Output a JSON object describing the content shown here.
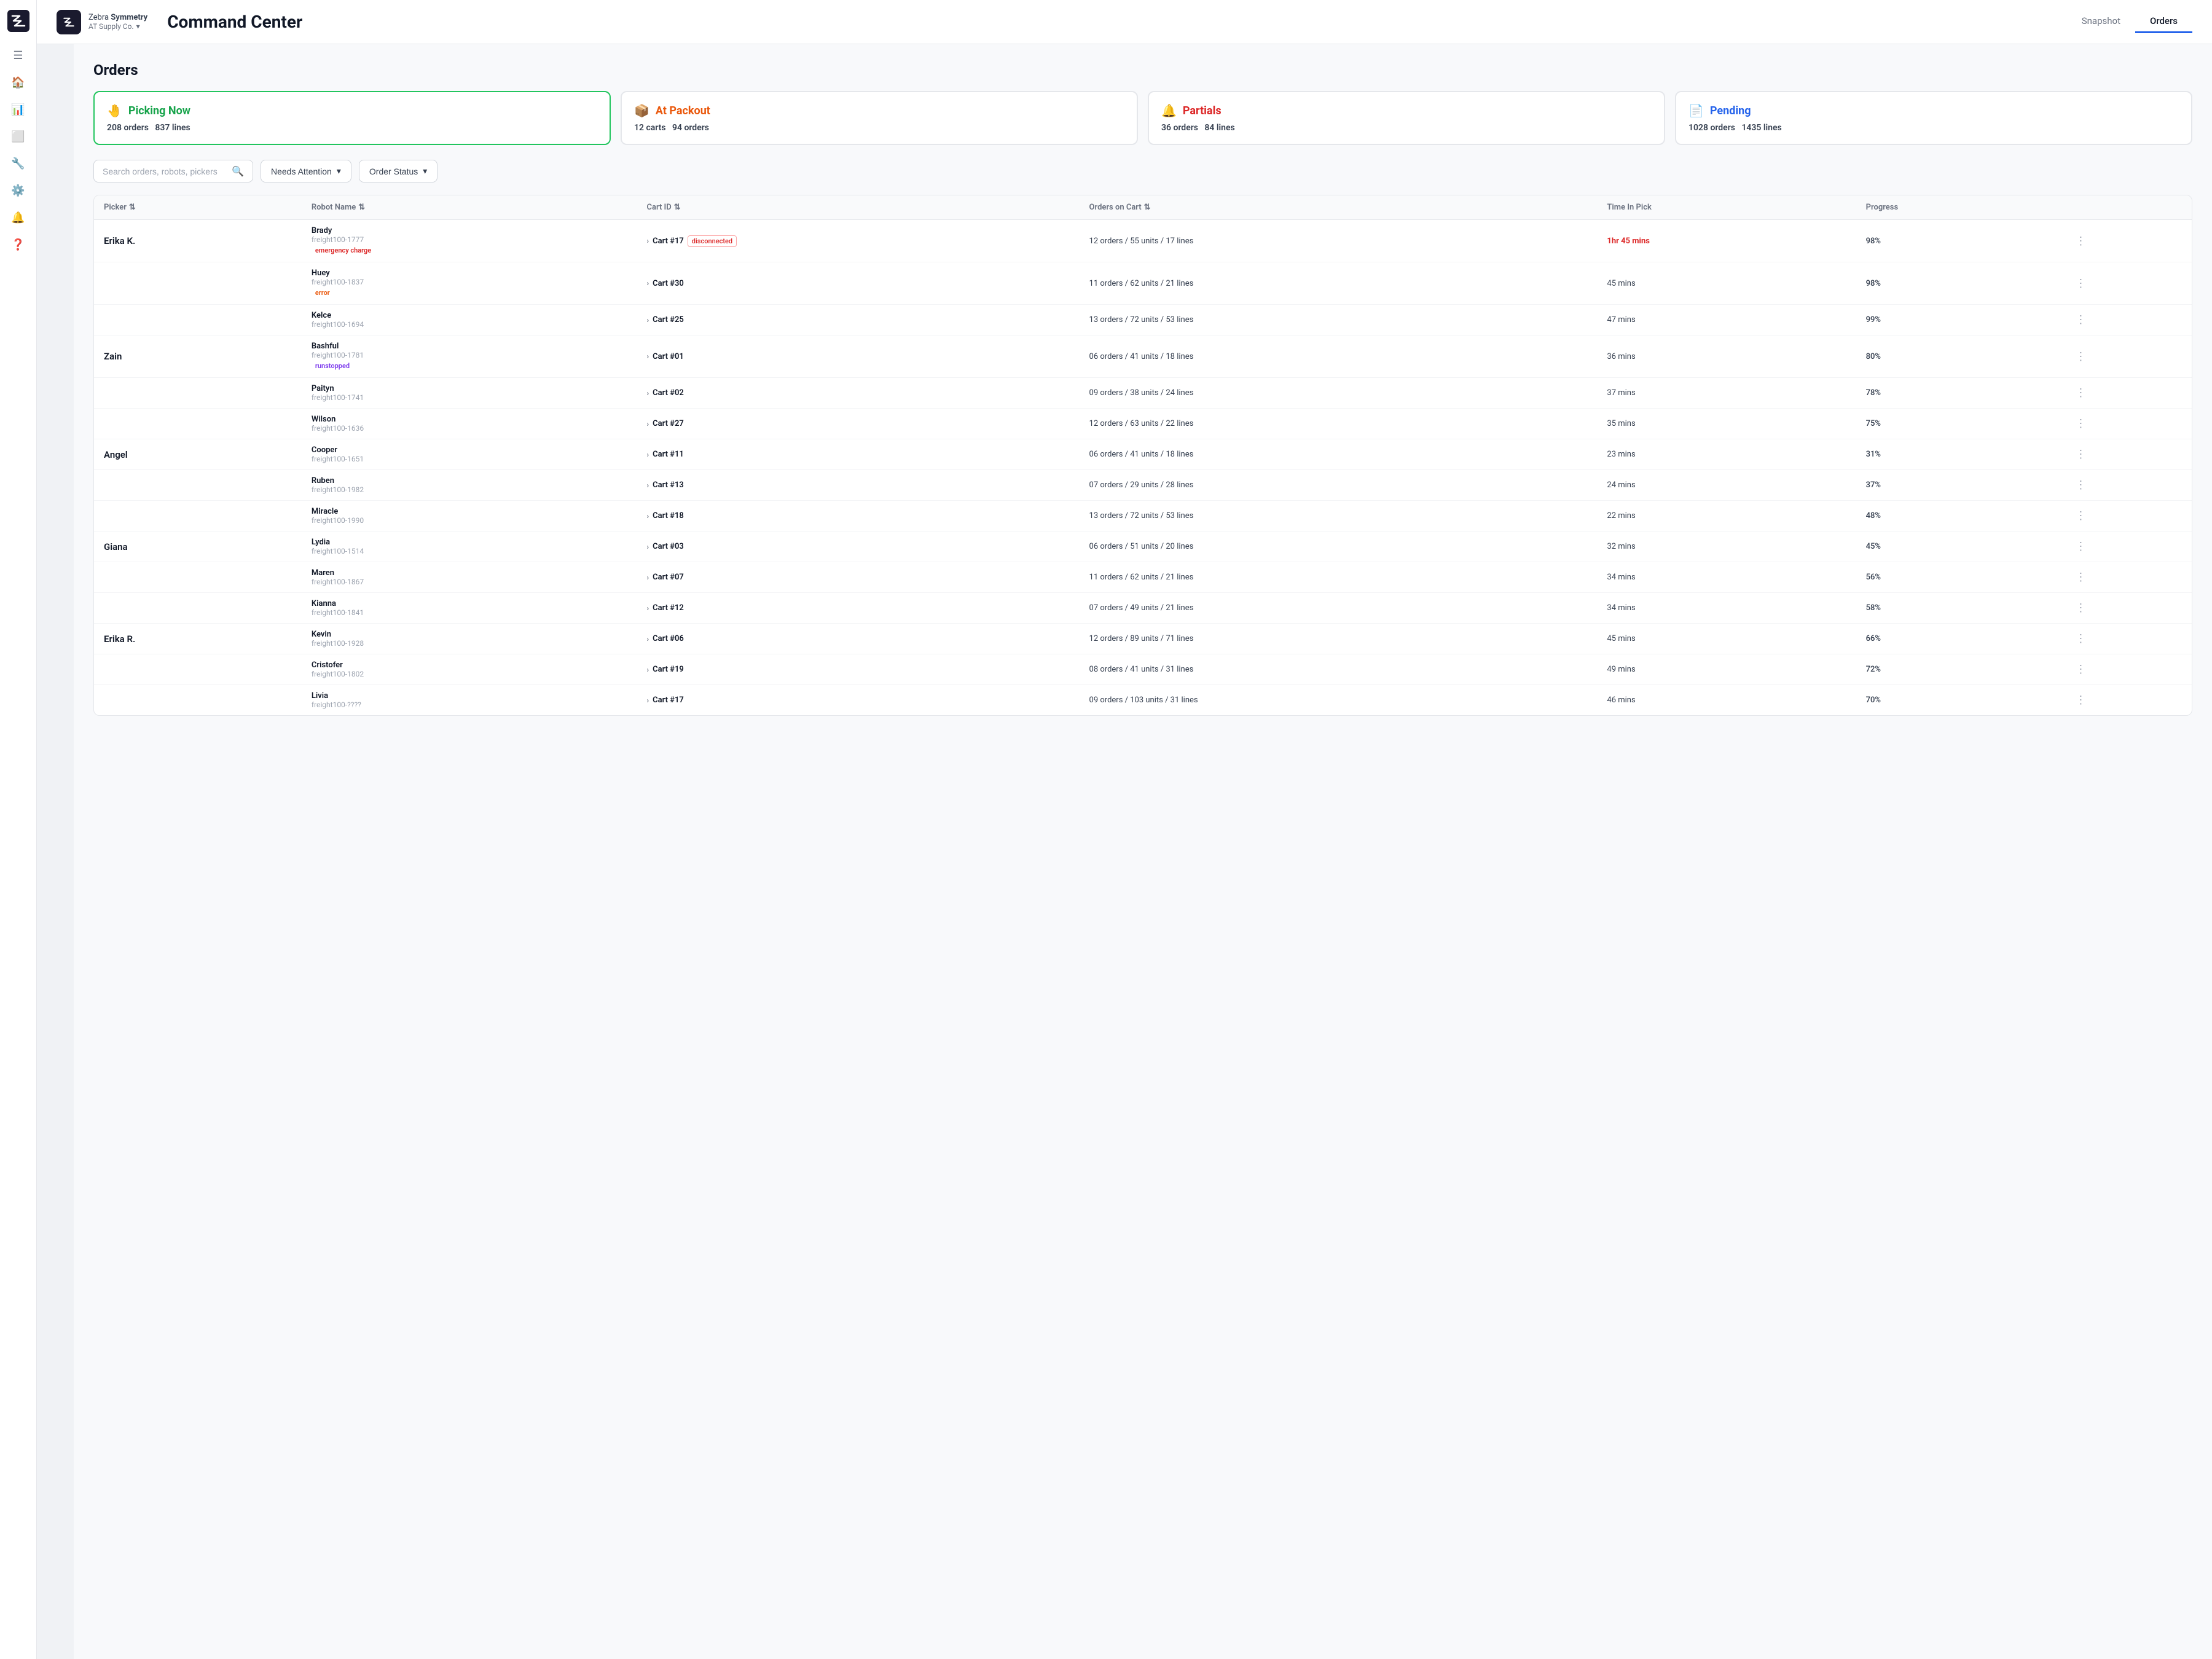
{
  "app": {
    "brand": "Zebra Symmetry",
    "brand_strong": "Symmetry",
    "brand_prefix": "Zebra ",
    "company": "AT Supply Co.",
    "page_title": "Command Center"
  },
  "nav": {
    "tabs": [
      {
        "id": "snapshot",
        "label": "Snapshot",
        "active": false
      },
      {
        "id": "orders",
        "label": "Orders",
        "active": true
      }
    ]
  },
  "page": {
    "heading": "Orders"
  },
  "status_cards": [
    {
      "id": "picking-now",
      "icon": "🤚",
      "title": "Picking Now",
      "title_color": "green",
      "active": true,
      "orders": "208 orders",
      "lines": "837 lines"
    },
    {
      "id": "at-packout",
      "icon": "📦",
      "title": "At Packout",
      "title_color": "orange",
      "active": false,
      "carts": "12 carts",
      "orders": "94 orders"
    },
    {
      "id": "partials",
      "icon": "🔔",
      "title": "Partials",
      "title_color": "red",
      "active": false,
      "orders": "36 orders",
      "lines": "84 lines"
    },
    {
      "id": "pending",
      "icon": "📄",
      "title": "Pending",
      "title_color": "blue",
      "active": false,
      "orders": "1028 orders",
      "lines": "1435 lines"
    }
  ],
  "filters": {
    "search_placeholder": "Search orders, robots, pickers",
    "filter1": "Needs Attention",
    "filter2": "Order Status"
  },
  "table": {
    "columns": [
      {
        "id": "picker",
        "label": "Picker",
        "sortable": true
      },
      {
        "id": "robot-name",
        "label": "Robot Name",
        "sortable": true
      },
      {
        "id": "cart-id",
        "label": "Cart ID",
        "sortable": true
      },
      {
        "id": "orders-on-cart",
        "label": "Orders on Cart",
        "sortable": true
      },
      {
        "id": "time-in-pick",
        "label": "Time In Pick",
        "sortable": false
      },
      {
        "id": "progress",
        "label": "Progress",
        "sortable": false
      }
    ],
    "rows": [
      {
        "picker": "Erika K.",
        "picker_show": true,
        "robot": "Brady",
        "robot_id": "freight100-1777",
        "badge": "emergency charge",
        "badge_type": "emergency",
        "cart": "Cart #17",
        "cart_status": "disconnected",
        "orders_on_cart": "12 orders / 55 units / 17 lines",
        "time": "1hr 45 mins",
        "time_alert": true,
        "progress": "98%",
        "row_start": true
      },
      {
        "picker": "",
        "picker_show": false,
        "robot": "Huey",
        "robot_id": "freight100-1837",
        "badge": "error",
        "badge_type": "error",
        "cart": "Cart #30",
        "cart_status": "",
        "orders_on_cart": "11 orders / 62 units / 21 lines",
        "time": "45 mins",
        "time_alert": false,
        "progress": "98%"
      },
      {
        "picker": "",
        "picker_show": false,
        "robot": "Kelce",
        "robot_id": "freight100-1694",
        "badge": "",
        "badge_type": "",
        "cart": "Cart #25",
        "cart_status": "",
        "orders_on_cart": "13 orders / 72 units / 53 lines",
        "time": "47 mins",
        "time_alert": false,
        "progress": "99%"
      },
      {
        "picker": "Zain",
        "picker_show": true,
        "robot": "Bashful",
        "robot_id": "freight100-1781",
        "badge": "runstopped",
        "badge_type": "runstopped",
        "cart": "Cart #01",
        "cart_status": "",
        "orders_on_cart": "06 orders / 41 units / 18 lines",
        "time": "36 mins",
        "time_alert": false,
        "progress": "80%",
        "row_start": true
      },
      {
        "picker": "",
        "picker_show": false,
        "robot": "Paityn",
        "robot_id": "freight100-1741",
        "badge": "",
        "badge_type": "",
        "cart": "Cart #02",
        "cart_status": "",
        "orders_on_cart": "09 orders / 38 units / 24 lines",
        "time": "37 mins",
        "time_alert": false,
        "progress": "78%"
      },
      {
        "picker": "",
        "picker_show": false,
        "robot": "Wilson",
        "robot_id": "freight100-1636",
        "badge": "",
        "badge_type": "",
        "cart": "Cart #27",
        "cart_status": "",
        "orders_on_cart": "12 orders / 63 units / 22 lines",
        "time": "35 mins",
        "time_alert": false,
        "progress": "75%"
      },
      {
        "picker": "Angel",
        "picker_show": true,
        "robot": "Cooper",
        "robot_id": "freight100-1651",
        "badge": "",
        "badge_type": "",
        "cart": "Cart #11",
        "cart_status": "",
        "orders_on_cart": "06 orders / 41 units / 18 lines",
        "time": "23 mins",
        "time_alert": false,
        "progress": "31%",
        "row_start": true
      },
      {
        "picker": "",
        "picker_show": false,
        "robot": "Ruben",
        "robot_id": "freight100-1982",
        "badge": "",
        "badge_type": "",
        "cart": "Cart #13",
        "cart_status": "",
        "orders_on_cart": "07 orders / 29 units / 28 lines",
        "time": "24 mins",
        "time_alert": false,
        "progress": "37%"
      },
      {
        "picker": "",
        "picker_show": false,
        "robot": "Miracle",
        "robot_id": "freight100-1990",
        "badge": "",
        "badge_type": "",
        "cart": "Cart #18",
        "cart_status": "",
        "orders_on_cart": "13 orders / 72 units / 53 lines",
        "time": "22 mins",
        "time_alert": false,
        "progress": "48%"
      },
      {
        "picker": "Giana",
        "picker_show": true,
        "robot": "Lydia",
        "robot_id": "freight100-1514",
        "badge": "",
        "badge_type": "",
        "cart": "Cart #03",
        "cart_status": "",
        "orders_on_cart": "06 orders / 51 units / 20 lines",
        "time": "32 mins",
        "time_alert": false,
        "progress": "45%",
        "row_start": true
      },
      {
        "picker": "",
        "picker_show": false,
        "robot": "Maren",
        "robot_id": "freight100-1867",
        "badge": "",
        "badge_type": "",
        "cart": "Cart #07",
        "cart_status": "",
        "orders_on_cart": "11 orders / 62 units / 21 lines",
        "time": "34 mins",
        "time_alert": false,
        "progress": "56%"
      },
      {
        "picker": "",
        "picker_show": false,
        "robot": "Kianna",
        "robot_id": "freight100-1841",
        "badge": "",
        "badge_type": "",
        "cart": "Cart #12",
        "cart_status": "",
        "orders_on_cart": "07 orders / 49 units / 21 lines",
        "time": "34 mins",
        "time_alert": false,
        "progress": "58%"
      },
      {
        "picker": "Erika R.",
        "picker_show": true,
        "robot": "Kevin",
        "robot_id": "freight100-1928",
        "badge": "",
        "badge_type": "",
        "cart": "Cart #06",
        "cart_status": "",
        "orders_on_cart": "12 orders / 89 units / 71 lines",
        "time": "45 mins",
        "time_alert": false,
        "progress": "66%",
        "row_start": true
      },
      {
        "picker": "",
        "picker_show": false,
        "robot": "Cristofer",
        "robot_id": "freight100-1802",
        "badge": "",
        "badge_type": "",
        "cart": "Cart #19",
        "cart_status": "",
        "orders_on_cart": "08 orders / 41 units / 31 lines",
        "time": "49 mins",
        "time_alert": false,
        "progress": "72%"
      },
      {
        "picker": "",
        "picker_show": false,
        "robot": "Livia",
        "robot_id": "freight100-????",
        "badge": "",
        "badge_type": "",
        "cart": "Cart #17",
        "cart_status": "",
        "orders_on_cart": "09 orders / 103 units / 31 lines",
        "time": "46 mins",
        "time_alert": false,
        "progress": "70%"
      }
    ]
  }
}
